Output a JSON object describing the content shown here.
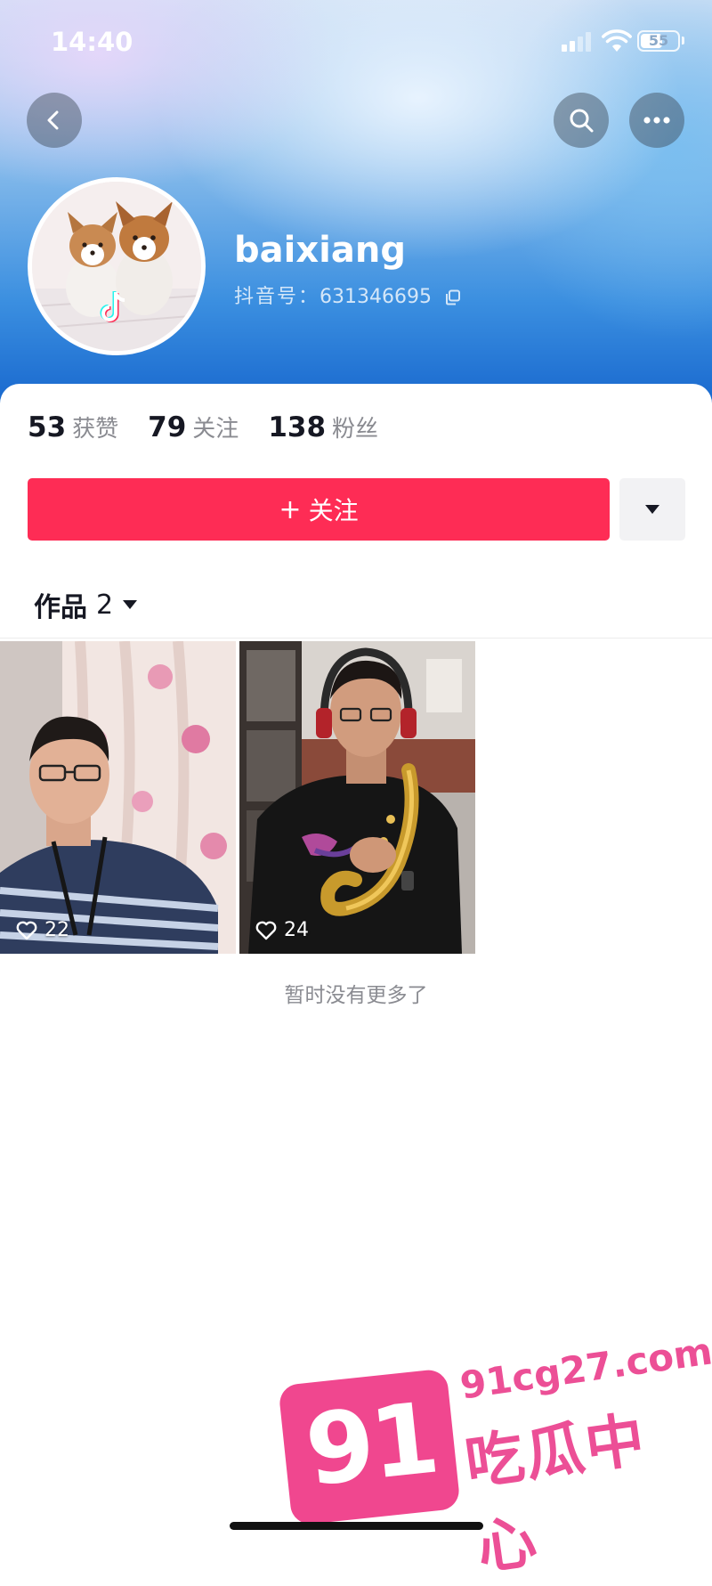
{
  "status_bar": {
    "time": "14:40",
    "battery": "55"
  },
  "profile": {
    "username": "baixiang",
    "douyin_id_label": "抖音号：",
    "douyin_id": "631346695"
  },
  "stats": [
    {
      "value": "53",
      "label": "获赞"
    },
    {
      "value": "79",
      "label": "关注"
    },
    {
      "value": "138",
      "label": "粉丝"
    }
  ],
  "actions": {
    "follow_plus": "+",
    "follow_label": "关注"
  },
  "works_tab": {
    "label": "作品",
    "count": "2"
  },
  "videos": [
    {
      "likes": "22"
    },
    {
      "likes": "24"
    }
  ],
  "footer": {
    "no_more": "暂时没有更多了"
  },
  "watermark": {
    "number": "91",
    "url": "91cg27.com",
    "name": "吃瓜中心"
  },
  "colors": {
    "accent": "#fe2c55",
    "watermark": "#ec4f96"
  },
  "icons": [
    "back-icon",
    "search-icon",
    "more-icon",
    "copy-icon",
    "caret-down-icon",
    "heart-icon",
    "tiktok-logo-icon"
  ]
}
